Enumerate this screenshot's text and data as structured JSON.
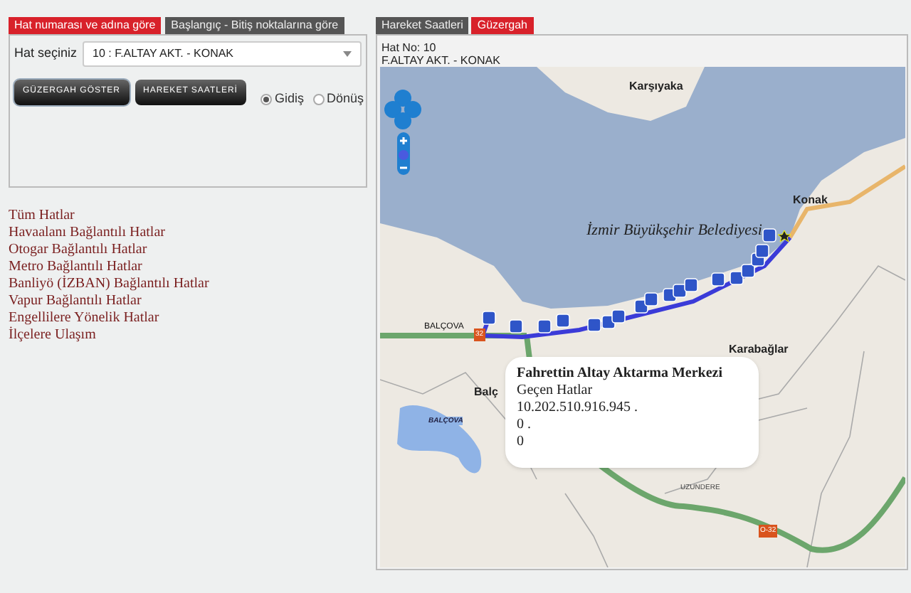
{
  "search_tabs": [
    {
      "label": "Hat numarası ve adına göre",
      "selected": true
    },
    {
      "label": "Başlangıç - Bitiş noktalarına göre",
      "selected": false
    }
  ],
  "form": {
    "line_label": "Hat seçiniz",
    "line_value": "10 : F.ALTAY AKT. - KONAK",
    "buttons": [
      "GÜZERGAH GÖSTER",
      "HAREKET SAATLERİ"
    ],
    "directions": [
      {
        "label": "Gidiş",
        "selected": true
      },
      {
        "label": "Dönüş",
        "selected": false
      }
    ]
  },
  "links": [
    "Tüm Hatlar",
    "Havaalanı Bağlantılı Hatlar",
    "Otogar Bağlantılı Hatlar",
    "Metro Bağlantılı Hatlar",
    "Banliyö (İZBAN) Bağlantılı Hatlar",
    "Vapur Bağlantılı Hatlar",
    "Engellilere Yönelik Hatlar",
    "İlçelere Ulaşım"
  ],
  "view_tabs": [
    {
      "label": "Hareket Saatleri",
      "selected": false
    },
    {
      "label": "Güzergah",
      "selected": true
    }
  ],
  "route_info": {
    "line_no": "Hat No: 10",
    "line_name": "F.ALTAY AKT. - KONAK"
  },
  "map": {
    "labels": [
      {
        "text": "Karşıyaka",
        "kind": "district"
      },
      {
        "text": "Konak",
        "kind": "district"
      },
      {
        "text": "İzmir Büyükşehir Belediyesi",
        "kind": "landmark"
      },
      {
        "text": "Karabağlar",
        "kind": "district"
      },
      {
        "text": "BALÇOVA",
        "kind": "road"
      },
      {
        "text": "Balç",
        "kind": "district"
      },
      {
        "text": "BALÇOVA",
        "kind": "lake"
      },
      {
        "text": "UZUNDERE",
        "kind": "place"
      }
    ],
    "shields": [
      "32",
      "O-32"
    ],
    "popup": {
      "title": "Fahrettin Altay Aktarma Merkezi",
      "lines": [
        "Geçen Hatlar",
        "10.202.510.916.945 .",
        "0 .",
        "0"
      ]
    }
  }
}
